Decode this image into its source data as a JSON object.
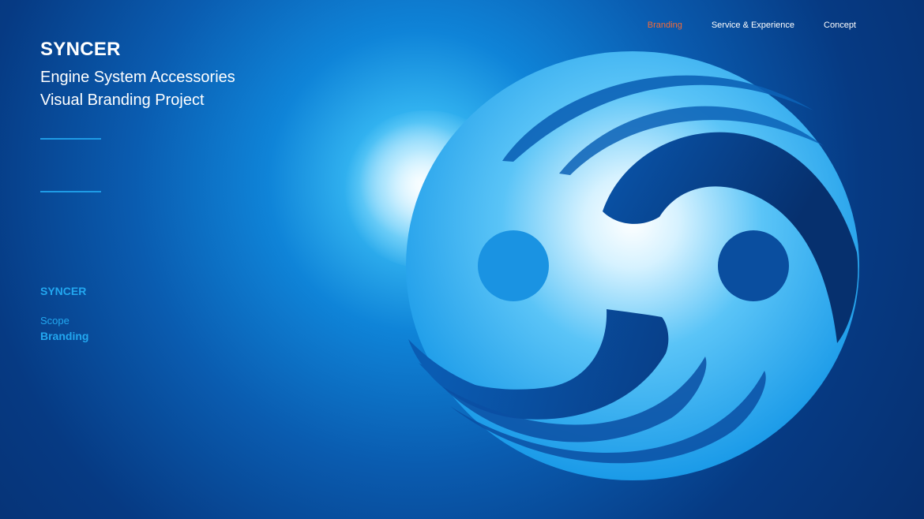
{
  "brand": {
    "title": "SYNCER",
    "subtitle_line1": "Engine System Accessories",
    "subtitle_line2": "Visual Branding Project"
  },
  "nav": {
    "items": [
      {
        "label": "Branding",
        "active": true
      },
      {
        "label": "Service & Experience",
        "active": false
      },
      {
        "label": "Concept",
        "active": false
      }
    ]
  },
  "meta": {
    "client": "SYNCER",
    "scope_label": "Scope",
    "scope_value": "Branding"
  },
  "colors": {
    "accent_active_nav": "#f26b3a",
    "accent_blue": "#22a7f0",
    "background_dark": "#062e6d"
  },
  "logo": {
    "icon": "syncer-logo-icon"
  }
}
